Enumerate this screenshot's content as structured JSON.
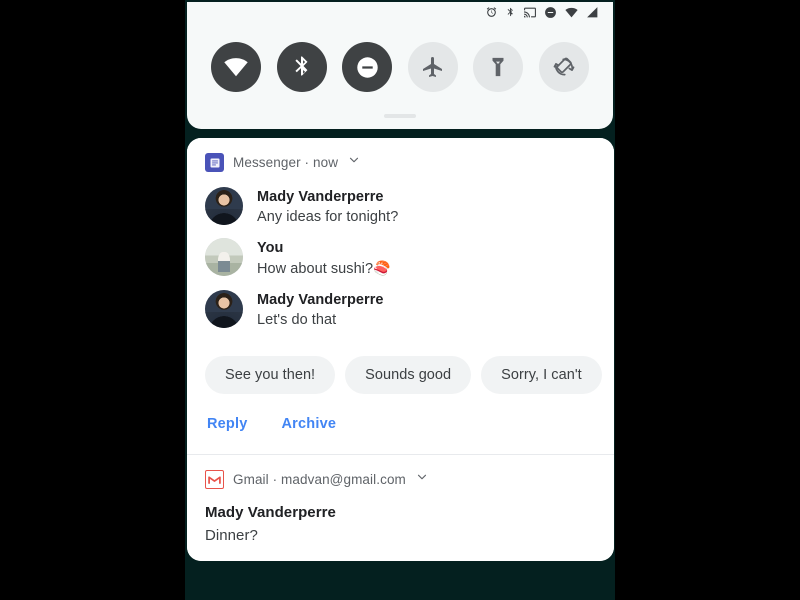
{
  "status_bar": {
    "icons": [
      {
        "name": "alarm-icon",
        "label": "Alarm set"
      },
      {
        "name": "bluetooth-icon",
        "label": "Bluetooth on"
      },
      {
        "name": "cast-icon",
        "label": "Casting"
      },
      {
        "name": "do-not-disturb-icon",
        "label": "Do not disturb"
      },
      {
        "name": "wifi-icon",
        "label": "Wi-Fi full signal"
      },
      {
        "name": "cell-signal-icon",
        "label": "Mobile signal"
      }
    ]
  },
  "quick_settings": {
    "tiles": [
      {
        "name": "wifi-tile",
        "label": "Wi-Fi",
        "state": "on"
      },
      {
        "name": "bluetooth-tile",
        "label": "Bluetooth",
        "state": "on"
      },
      {
        "name": "do-not-disturb-tile",
        "label": "Do Not Disturb",
        "state": "on"
      },
      {
        "name": "airplane-mode-tile",
        "label": "Airplane mode",
        "state": "off"
      },
      {
        "name": "flashlight-tile",
        "label": "Flashlight",
        "state": "off"
      },
      {
        "name": "auto-rotate-tile",
        "label": "Auto-rotate",
        "state": "off"
      }
    ],
    "handle_label": "Drag handle"
  },
  "notifications": [
    {
      "id": "messenger",
      "app_name": "Messenger",
      "separator": "·",
      "timestamp": "now",
      "header_text": "Messenger · now",
      "app_icon": "messenger-icon",
      "accent_color": "#4a53b8",
      "messages": [
        {
          "sender": "Mady Vanderperre",
          "text": "Any ideas for tonight?",
          "avatar": "av-person"
        },
        {
          "sender": "You",
          "text": "How about sushi?",
          "emoji": "🍣",
          "avatar": "av-outdoor"
        },
        {
          "sender": "Mady Vanderperre",
          "text": "Let's do that",
          "avatar": "av-person"
        }
      ],
      "smart_replies": [
        "See you then!",
        "Sounds good",
        "Sorry, I can't"
      ],
      "actions": [
        "Reply",
        "Archive"
      ],
      "action_color": "#4285f4"
    },
    {
      "id": "gmail",
      "app_name": "Gmail",
      "separator": "·",
      "account": "madvan@gmail.com",
      "header_text": "Gmail · madvan@gmail.com",
      "app_icon": "gmail-icon",
      "accent_color": "#e8534a",
      "sender": "Mady Vanderperre",
      "subject": "Dinner?"
    }
  ]
}
